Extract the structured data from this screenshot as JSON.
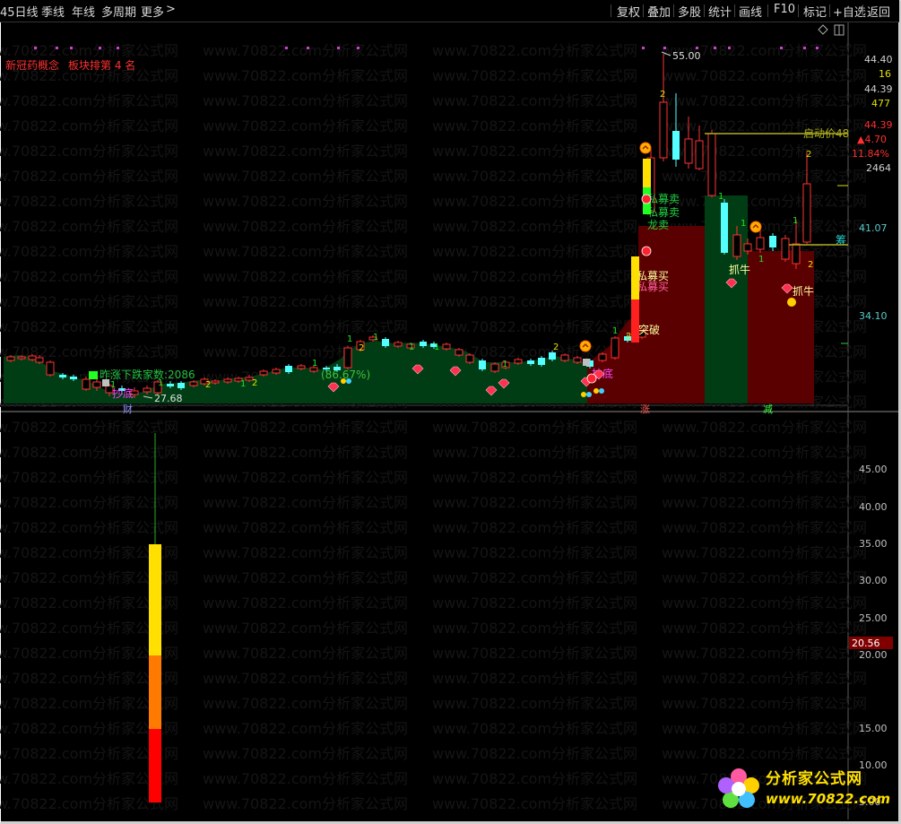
{
  "toolbar": {
    "left": [
      "45日线",
      "季线",
      "年线",
      "多周期",
      "更多"
    ],
    "more_arrow": ">",
    "right": [
      "复权",
      "叠加",
      "多股",
      "统计",
      "画线",
      "F10",
      "标记",
      "+自选",
      "返回"
    ]
  },
  "watermark": "www.70822.com分析家公式网",
  "header": {
    "sector_label": "新冠药概念",
    "rank_text": "板块排第 4 名"
  },
  "right_panel": {
    "values": [
      "44.40",
      "16",
      "44.39",
      "477",
      "44.39",
      "▲4.70",
      "11.84%",
      "2464"
    ],
    "axis_ticks": [
      "41.07",
      "34.10"
    ],
    "cut_label": "筹"
  },
  "annotations": {
    "max_price": "55.00",
    "min_price": "27.68",
    "start_price": "启动价48",
    "fall_count": "昨涨下跌家数:2086",
    "pct_label": "(86.67%)",
    "chaodi": "抄底",
    "chaodi2": "抄底",
    "tupo": "突破",
    "zhuniu": "抓牛",
    "zhuniu2": "抓牛",
    "maimai1": "私募卖",
    "maimai2": "私募卖",
    "maimai3": "私募买",
    "maimai4": "私募买",
    "longmai": "龙卖",
    "cai": "财",
    "zhang": "涨",
    "jian": "减",
    "num1": "1",
    "num2": "2"
  },
  "lower_panel": {
    "axis_ticks": [
      "45.00",
      "40.00",
      "35.00",
      "30.00",
      "25.00",
      "20.00",
      "15.00",
      "10.00",
      "5.00"
    ],
    "current_value": "20.56"
  },
  "logo": {
    "name": "分析家公式网",
    "url": "www.70822.com"
  },
  "colors": {
    "up": "#ff3232",
    "down": "#54ffff",
    "bg": "#000000",
    "green_area": "#003d14",
    "red_area": "#5a0000",
    "accent_yellow": "#ffe000"
  }
}
